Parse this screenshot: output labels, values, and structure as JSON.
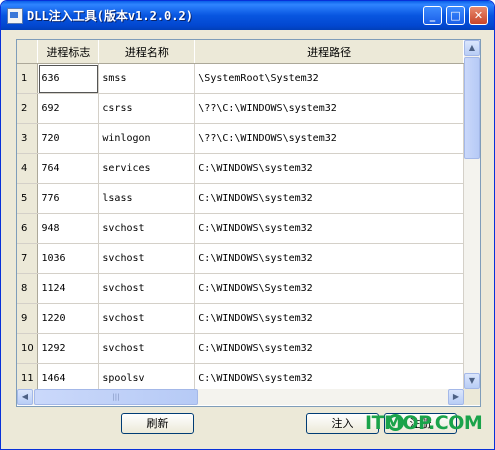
{
  "window": {
    "title": "DLL注入工具(版本v1.2.0.2)"
  },
  "title_buttons": {
    "minimize": "_",
    "maximize": "□",
    "close": "✕"
  },
  "table": {
    "headers": {
      "row_num": "",
      "pid": "进程标志",
      "name": "进程名称",
      "path": "进程路径"
    },
    "rows": [
      {
        "num": "1",
        "pid": "636",
        "name": "smss",
        "path": "\\SystemRoot\\System32"
      },
      {
        "num": "2",
        "pid": "692",
        "name": "csrss",
        "path": "\\??\\C:\\WINDOWS\\system32"
      },
      {
        "num": "3",
        "pid": "720",
        "name": "winlogon",
        "path": "\\??\\C:\\WINDOWS\\system32"
      },
      {
        "num": "4",
        "pid": "764",
        "name": "services",
        "path": "C:\\WINDOWS\\system32"
      },
      {
        "num": "5",
        "pid": "776",
        "name": "lsass",
        "path": "C:\\WINDOWS\\system32"
      },
      {
        "num": "6",
        "pid": "948",
        "name": "svchost",
        "path": "C:\\WINDOWS\\system32"
      },
      {
        "num": "7",
        "pid": "1036",
        "name": "svchost",
        "path": "C:\\WINDOWS\\system32"
      },
      {
        "num": "8",
        "pid": "1124",
        "name": "svchost",
        "path": "C:\\WINDOWS\\System32"
      },
      {
        "num": "9",
        "pid": "1220",
        "name": "svchost",
        "path": "C:\\WINDOWS\\system32"
      },
      {
        "num": "10",
        "pid": "1292",
        "name": "svchost",
        "path": "C:\\WINDOWS\\system32"
      },
      {
        "num": "11",
        "pid": "1464",
        "name": "spoolsv",
        "path": "C:\\WINDOWS\\system32"
      }
    ]
  },
  "scroll": {
    "up": "▲",
    "down": "▼",
    "left": "◀",
    "right": "▶",
    "grip": "|||"
  },
  "buttons": {
    "refresh": "刷新",
    "inject": "注入",
    "uninject": "注册"
  },
  "watermark": {
    "text": "ITMOP.COM"
  }
}
